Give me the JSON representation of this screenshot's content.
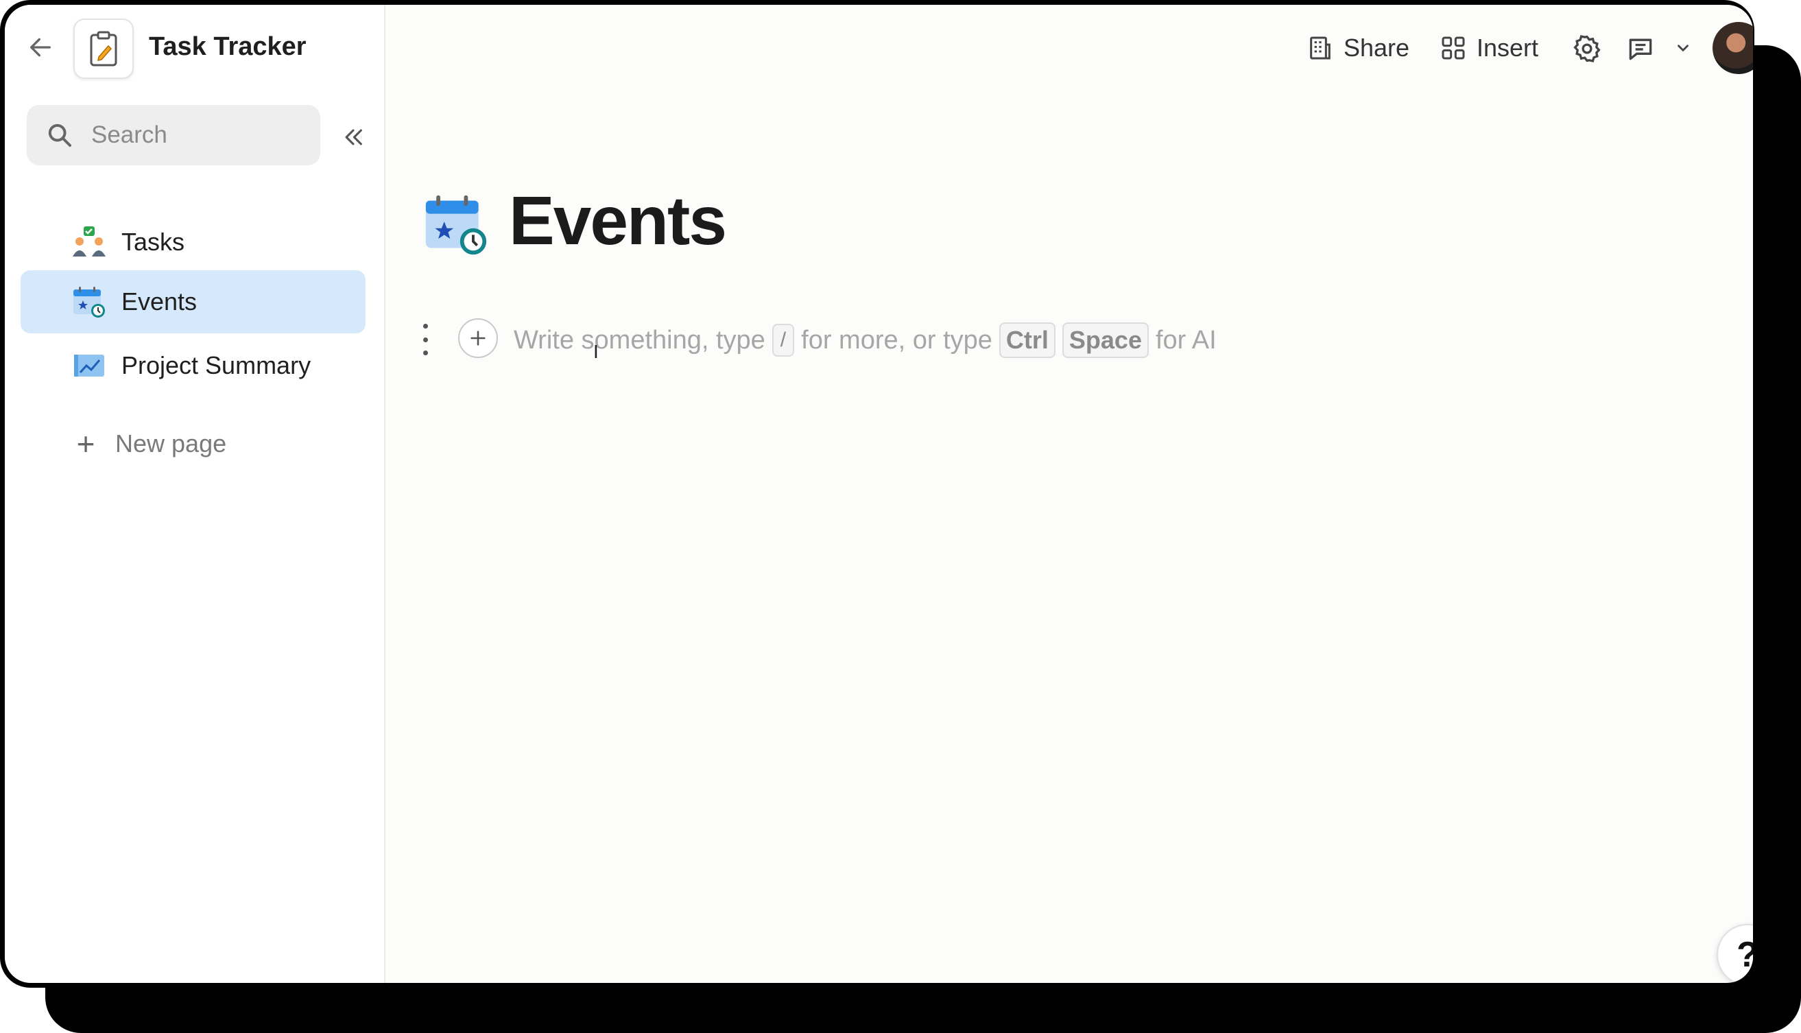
{
  "app": {
    "doc_title": "Task Tracker"
  },
  "sidebar": {
    "search_placeholder": "Search",
    "items": [
      {
        "label": "Tasks",
        "icon": "tasks-people-icon",
        "active": false
      },
      {
        "label": "Events",
        "icon": "calendar-clock-icon",
        "active": true
      },
      {
        "label": "Project Summary",
        "icon": "chart-image-icon",
        "active": false
      }
    ],
    "new_page_label": "New page"
  },
  "toolbar": {
    "share_label": "Share",
    "insert_label": "Insert"
  },
  "page": {
    "title": "Events",
    "placeholder_parts": {
      "part1": "Write something, type",
      "slash_key": "/",
      "part2": "for more, or type",
      "key_ctrl": "Ctrl",
      "key_space": "Space",
      "part3": "for AI"
    }
  },
  "help": {
    "label": "?"
  },
  "colors": {
    "active_item_bg": "#d6e8fb",
    "calendar_blue": "#2f8ee8",
    "accent_green": "#2ea44f"
  }
}
